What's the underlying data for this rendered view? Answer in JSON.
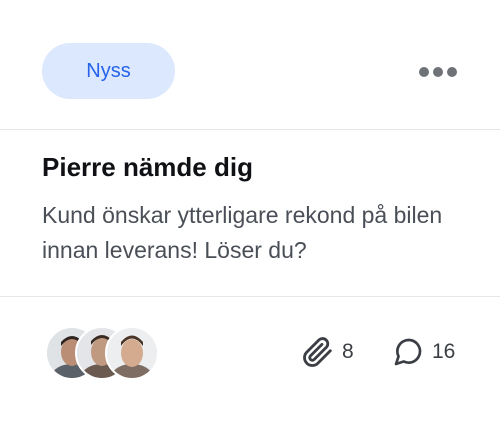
{
  "notification": {
    "badge_label": "Nyss",
    "title": "Pierre nämde dig",
    "message": "Kund önskar ytterligare rekond på bilen innan leverans! Löser du?",
    "attachments_count": "8",
    "comments_count": "16",
    "icons": {
      "more": "more-horizontal-icon",
      "attachment": "paperclip-icon",
      "comment": "speech-bubble-icon"
    },
    "colors": {
      "badge_bg": "#dce8fd",
      "badge_text": "#2563eb",
      "title": "#0f1115",
      "body_text": "#4a4f57"
    }
  }
}
